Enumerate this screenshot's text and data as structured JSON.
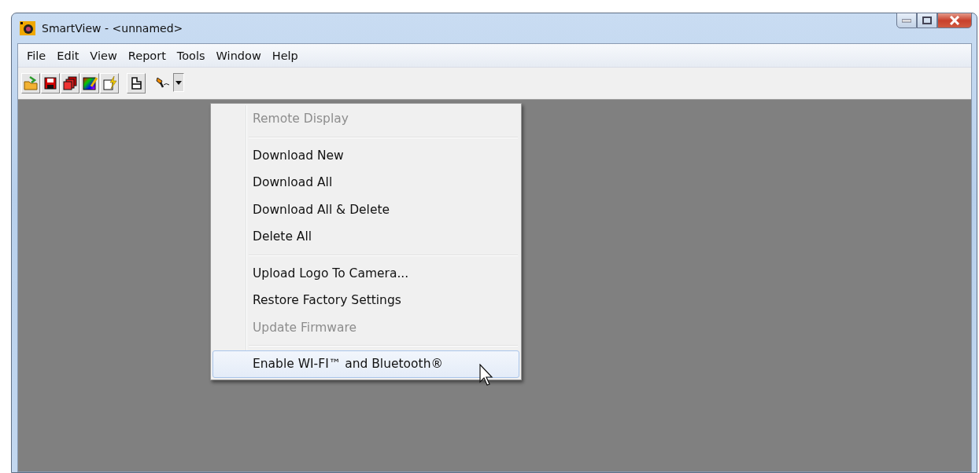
{
  "window": {
    "title": "SmartView - <unnamed>"
  },
  "menubar": [
    "File",
    "Edit",
    "View",
    "Report",
    "Tools",
    "Window",
    "Help"
  ],
  "toolbar": {
    "groups": [
      [
        {
          "kind": "open"
        },
        {
          "kind": "save"
        },
        {
          "kind": "pages"
        },
        {
          "kind": "palette"
        },
        {
          "kind": "flash"
        }
      ],
      [
        {
          "kind": "page"
        }
      ],
      [
        {
          "kind": "camera",
          "dropdown": true,
          "expanded": true
        }
      ]
    ]
  },
  "dropdown_menu": {
    "groups": [
      [
        {
          "label": "Remote Display",
          "disabled": true,
          "selected": false
        }
      ],
      [
        {
          "label": "Download New",
          "disabled": false,
          "selected": false
        },
        {
          "label": "Download All",
          "disabled": false,
          "selected": false
        },
        {
          "label": "Download All & Delete",
          "disabled": false,
          "selected": false
        },
        {
          "label": "Delete All",
          "disabled": false,
          "selected": false
        }
      ],
      [
        {
          "label": "Upload Logo To Camera...",
          "disabled": false,
          "selected": false
        },
        {
          "label": "Restore Factory Settings",
          "disabled": false,
          "selected": false
        },
        {
          "label": "Update Firmware",
          "disabled": true,
          "selected": false
        }
      ],
      [
        {
          "label": "Enable WI-FI™ and Bluetooth®",
          "disabled": false,
          "selected": true
        }
      ]
    ]
  }
}
